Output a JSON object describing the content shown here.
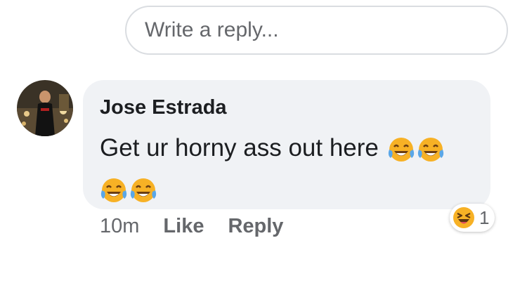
{
  "reply": {
    "placeholder": "Write a reply..."
  },
  "comment": {
    "author": "Jose Estrada",
    "text": "Get ur horny ass out here",
    "emoji": "face-with-tears-of-joy-icon",
    "emoji_count": 4,
    "timestamp": "10m",
    "like_label": "Like",
    "reply_label": "Reply",
    "reaction": {
      "icon": "laughing-squint-face-icon",
      "count": "1"
    }
  },
  "colors": {
    "bubble_bg": "#f0f2f5",
    "meta_text": "#65676b",
    "emoji_yellow": "#f7b125"
  }
}
